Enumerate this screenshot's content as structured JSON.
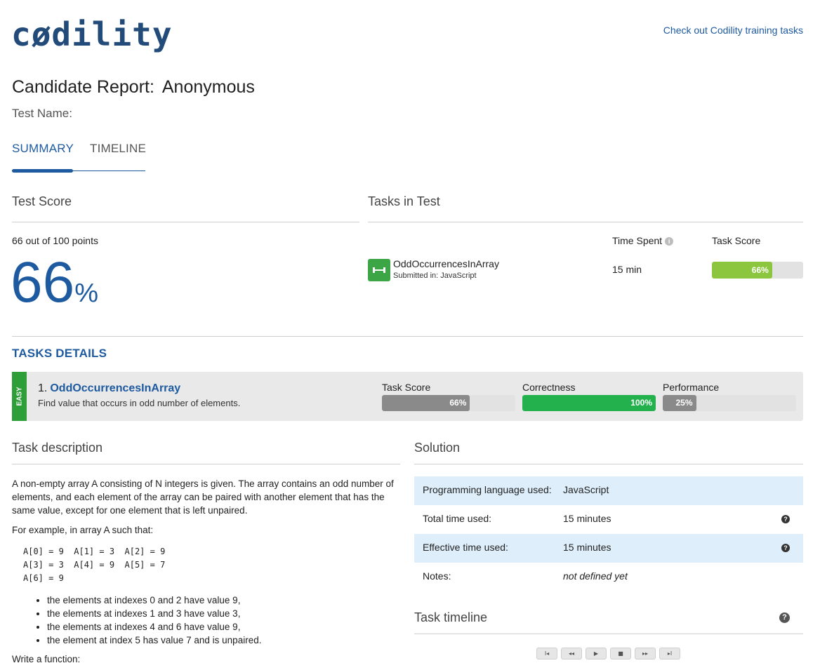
{
  "header": {
    "logo_text": "cødility",
    "training_link": "Check out Codility training tasks"
  },
  "report": {
    "title_prefix": "Candidate Report:",
    "candidate": "Anonymous",
    "test_name_label": "Test Name:"
  },
  "tabs": [
    {
      "label": "SUMMARY",
      "active": true
    },
    {
      "label": "TIMELINE",
      "active": false
    }
  ],
  "test_score": {
    "heading": "Test Score",
    "points_text": "66 out of 100 points",
    "percent": "66",
    "percent_sign": "%"
  },
  "tasks_in_test": {
    "heading": "Tasks in Test",
    "col_time_spent": "Time Spent",
    "col_task_score": "Task Score",
    "task": {
      "name": "OddOccurrencesInArray",
      "submitted": "Submitted in: JavaScript",
      "time_spent": "15 min",
      "score_label": "66%",
      "score_value": 0.66
    }
  },
  "tasks_details": {
    "heading": "TASKS DETAILS",
    "difficulty": "EASY",
    "number": "1.",
    "name": "OddOccurrencesInArray",
    "description": "Find value that occurs in odd number of elements.",
    "task_score": {
      "label": "Task Score",
      "value_label": "66%",
      "value": 0.66
    },
    "correctness": {
      "label": "Correctness",
      "value_label": "100%",
      "value": 1.0
    },
    "performance": {
      "label": "Performance",
      "value_label": "25%",
      "value": 0.25
    }
  },
  "task_description": {
    "heading": "Task description",
    "para1": "A non-empty array A consisting of N integers is given. The array contains an odd number of elements, and each element of the array can be paired with another element that has the same value, except for one element that is left unpaired.",
    "para2": "For example, in array A such that:",
    "code": "A[0] = 9  A[1] = 3  A[2] = 9\nA[3] = 3  A[4] = 9  A[5] = 7\nA[6] = 9",
    "bullets": [
      "the elements at indexes 0 and 2 have value 9,",
      "the elements at indexes 1 and 3 have value 3,",
      "the elements at indexes 4 and 6 have value 9,",
      "the element at index 5 has value 7 and is unpaired."
    ],
    "para3": "Write a function:"
  },
  "solution": {
    "heading": "Solution",
    "rows": [
      {
        "key": "Programming language used:",
        "value": "JavaScript"
      },
      {
        "key": "Total time used:",
        "value": "15 minutes"
      },
      {
        "key": "Effective time used:",
        "value": "15 minutes"
      },
      {
        "key": "Notes:",
        "value": "not defined yet"
      }
    ],
    "help_glyph": "?"
  },
  "task_timeline": {
    "heading": "Task timeline",
    "controls": [
      "I◂",
      "◂◂",
      "▶",
      "■",
      "▸▸",
      "▸I"
    ]
  },
  "colors": {
    "brand_blue": "#1d5aa0",
    "green": "#2e9e38",
    "light_green": "#8cc63f",
    "bright_green": "#22b14c",
    "grey_fill": "#8a8a8a"
  }
}
